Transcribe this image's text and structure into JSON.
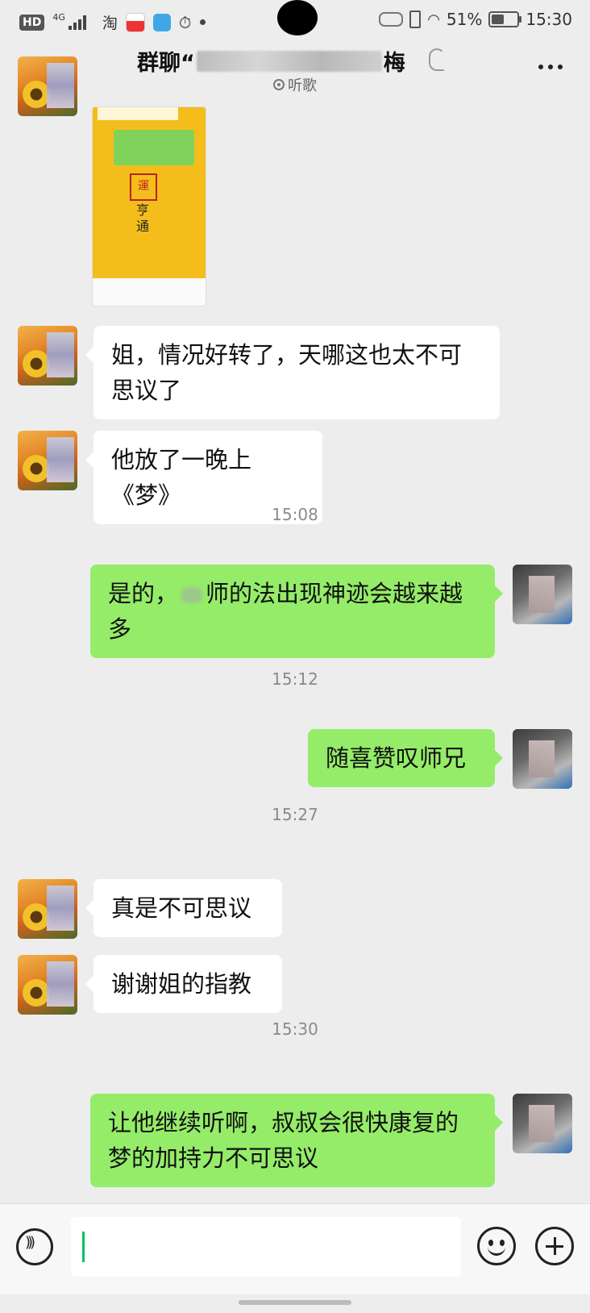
{
  "status_bar": {
    "network": "4G",
    "hd": "HD",
    "taobao": "淘",
    "battery": "51%",
    "battery_level": 0.51,
    "time": "15:30"
  },
  "header": {
    "title_prefix": "群聊“",
    "title_suffix": "梅",
    "subtitle": "听歌"
  },
  "image_message": {
    "stamp": "運",
    "chars": "亨\n通"
  },
  "messages": [
    {
      "side": "in",
      "text": "姐，情况好转了，天哪这也太不可思议了"
    },
    {
      "side": "in",
      "text": "他放了一晚上《梦》"
    },
    {
      "type": "time",
      "text": "15:08"
    },
    {
      "side": "out",
      "text_a": "是的，",
      "text_b": "师的法出现神迹会越来越多"
    },
    {
      "type": "time",
      "text": "15:12"
    },
    {
      "side": "out",
      "text": "随喜赞叹师兄"
    },
    {
      "type": "time",
      "text": "15:27"
    },
    {
      "side": "in",
      "text": "真是不可思议"
    },
    {
      "side": "in",
      "text": "谢谢姐的指教"
    },
    {
      "type": "time",
      "text": "15:30"
    },
    {
      "side": "out",
      "text": "让他继续听啊，叔叔会很快康复的梦的加持力不可思议"
    }
  ],
  "input_bar": {
    "input_value": ""
  }
}
